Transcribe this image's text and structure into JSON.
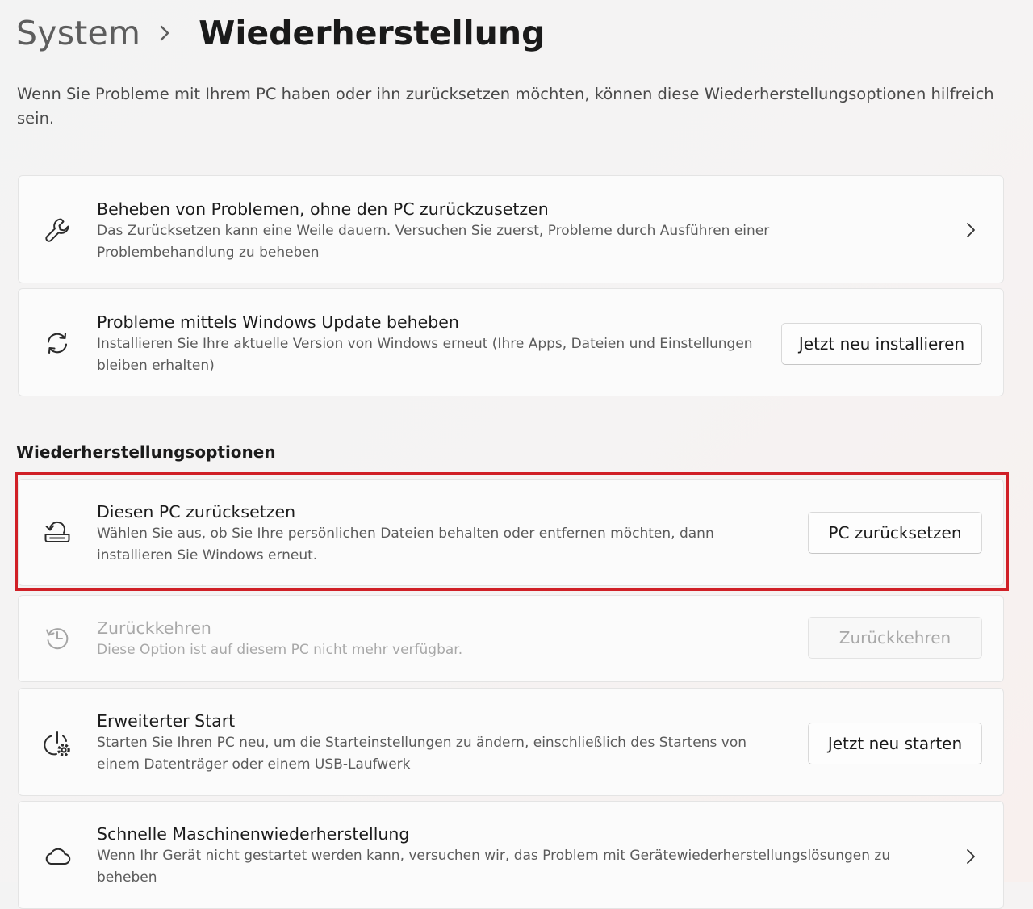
{
  "breadcrumb": {
    "parent": "System",
    "current": "Wiederherstellung"
  },
  "intro": "Wenn Sie Probleme mit Ihrem PC haben oder ihn zurücksetzen möchten, können diese Wiederherstellungsoptionen hilfreich sein.",
  "cards": {
    "fix_problems": {
      "icon": "wrench-icon",
      "title": "Beheben von Problemen, ohne den PC zurückzusetzen",
      "description": "Das Zurücksetzen kann eine Weile dauern. Versuchen Sie zuerst, Probleme durch Ausführen einer Problembehandlung zu beheben"
    },
    "windows_update": {
      "icon": "refresh-icon",
      "title": "Probleme mittels Windows Update beheben",
      "description": "Installieren Sie Ihre aktuelle Version von Windows erneut (Ihre Apps, Dateien und Einstellungen bleiben erhalten)",
      "button": "Jetzt neu installieren"
    }
  },
  "section": {
    "heading": "Wiederherstellungsoptionen",
    "items": {
      "reset_pc": {
        "icon": "reset-pc-icon",
        "title": "Diesen PC zurücksetzen",
        "description": "Wählen Sie aus, ob Sie Ihre persönlichen Dateien behalten oder entfernen möchten, dann installieren Sie Windows erneut.",
        "button": "PC zurücksetzen",
        "highlighted": true,
        "highlight_color": "#d01f26"
      },
      "go_back": {
        "icon": "history-icon",
        "title": "Zurückkehren",
        "description": "Diese Option ist auf diesem PC nicht mehr verfügbar.",
        "button": "Zurückkehren",
        "disabled": true
      },
      "advanced_start": {
        "icon": "power-gear-icon",
        "title": "Erweiterter Start",
        "description": "Starten Sie Ihren PC neu, um die Starteinstellungen zu ändern, einschließlich des Startens von einem Datenträger oder einem USB-Laufwerk",
        "button": "Jetzt neu starten"
      },
      "quick_recovery": {
        "icon": "cloud-icon",
        "title": "Schnelle Maschinenwiederherstellung",
        "description": "Wenn Ihr Gerät nicht gestartet werden kann, versuchen wir, das Problem mit Gerätewiederherstellungslösungen zu beheben"
      }
    }
  },
  "colors": {
    "card_background": "#fbfbfb",
    "card_border": "#e4e4e4",
    "highlight": "#d01f26",
    "disabled_text": "#a8a8a8"
  }
}
